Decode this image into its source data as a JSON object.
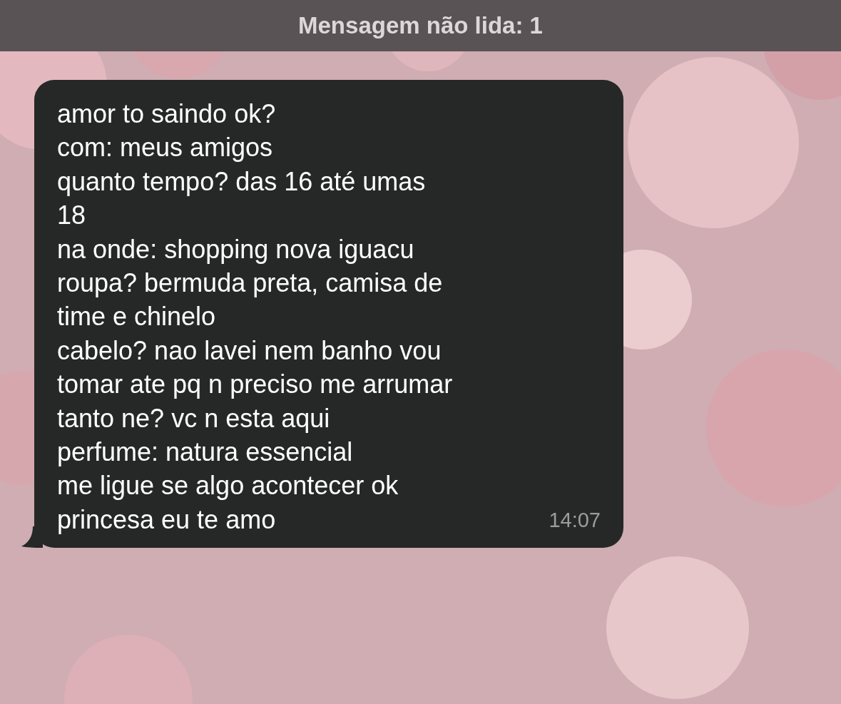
{
  "header": {
    "title": "Mensagem não lida: 1"
  },
  "message": {
    "text": "amor to saindo ok?\ncom: meus amigos\nquanto tempo? das 16 até umas\n18\nna onde: shopping nova iguacu\nroupa? bermuda preta, camisa de\ntime e chinelo\ncabelo? nao lavei nem banho vou\ntomar ate pq n preciso me arrumar\ntanto ne? vc n esta aqui\nperfume: natura essencial\nme ligue se algo acontecer ok\nprincesa eu te amo",
    "time": "14:07"
  }
}
